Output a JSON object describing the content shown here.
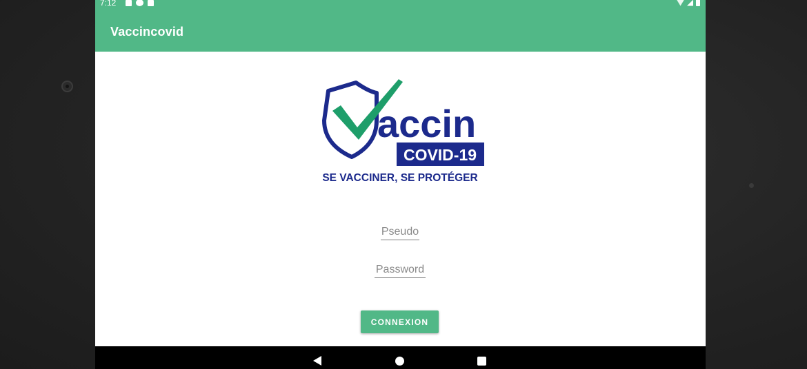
{
  "status_bar": {
    "time": "7:12",
    "left_icons": [
      "a-notification-icon",
      "p-notification-icon",
      "sd-card-icon"
    ],
    "right_icons": [
      "wifi-icon",
      "signal-icon",
      "battery-icon"
    ]
  },
  "app_bar": {
    "title": "Vaccincovid"
  },
  "logo": {
    "word": "accin",
    "badge": "COVID-19",
    "tagline": "SE VACCINER, SE PROTÉGER",
    "colors": {
      "navy": "#1c2a8c",
      "green": "#1e9e6a"
    }
  },
  "form": {
    "username_placeholder": "Pseudo",
    "password_placeholder": "Password",
    "submit_label": "CONNEXION"
  },
  "nav_bar": {
    "icons": [
      "back-icon",
      "home-icon",
      "recents-icon"
    ]
  },
  "colors": {
    "accent": "#51b887",
    "frame": "#262626",
    "nav": "#000000"
  }
}
